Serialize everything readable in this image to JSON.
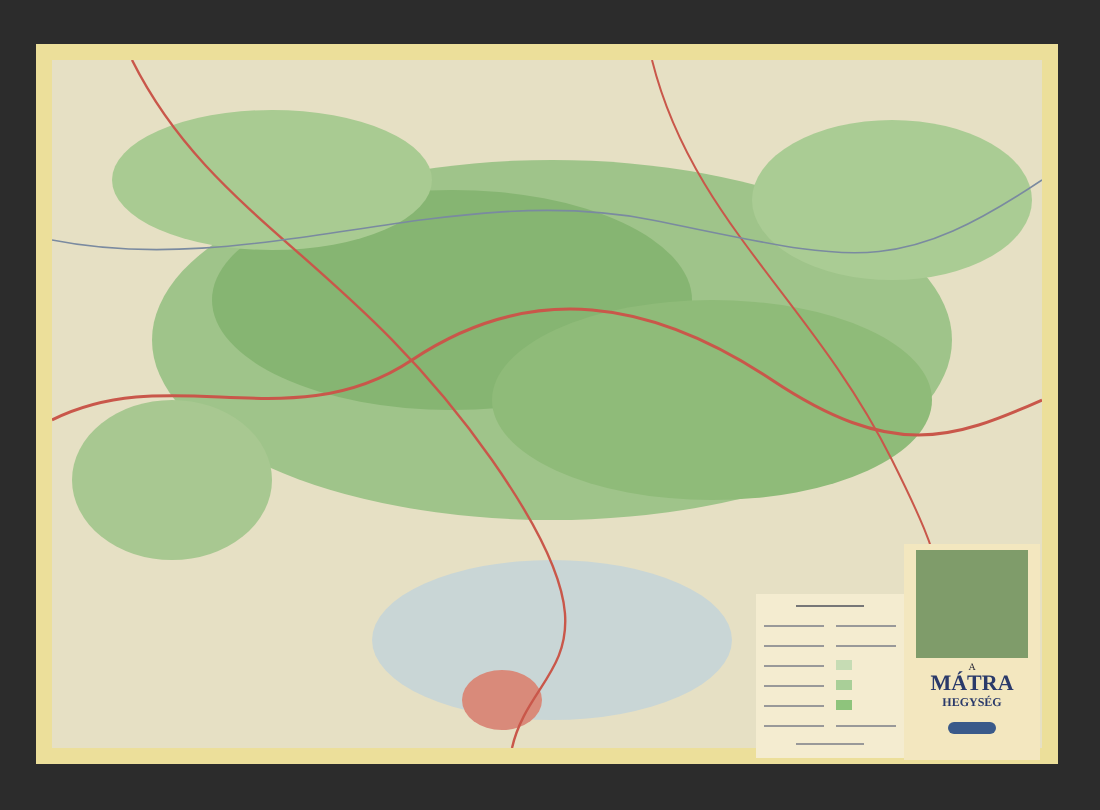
{
  "cover": {
    "pretitle": "A",
    "title": "MÁTRA",
    "subtitle": "HEGYSÉG"
  }
}
